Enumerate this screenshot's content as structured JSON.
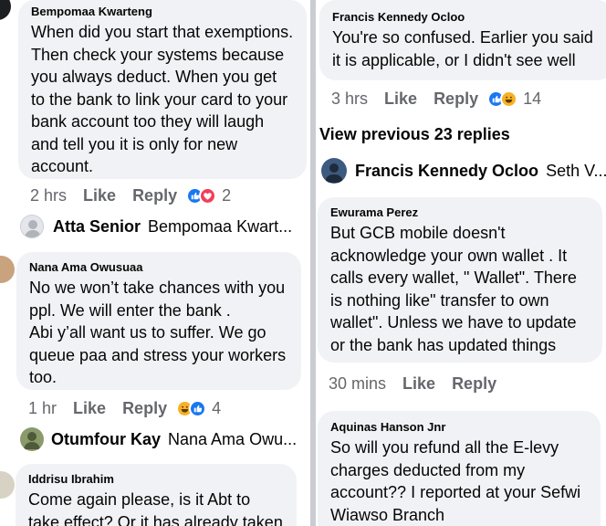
{
  "left": {
    "comments": [
      {
        "author": "Bempomaa Kwarteng",
        "text": "When did you start that exemptions. Then check your systems because you always deduct. When you get to the bank to link your card to your bank account too they will laugh and tell you it is only for new account.",
        "time": "2 hrs",
        "like": "Like",
        "reply": "Reply",
        "reactions": [
          "like-icon",
          "love-icon"
        ],
        "count": "2"
      },
      {
        "author": "Nana Ama Owusuaa",
        "text": "No we won’t take chances with you ppl. We will enter the bank .\nAbi y’all want us to suffer. We go queue paa and stress your workers too.",
        "time": "1 hr",
        "like": "Like",
        "reply": "Reply",
        "reactions": [
          "haha-icon",
          "like-icon"
        ],
        "count": "4"
      },
      {
        "author": "Iddrisu Ibrahim",
        "text": "Come again please, is it Abt to take effect? Or it has already taken"
      }
    ],
    "replies": [
      {
        "name": "Atta Senior",
        "preview": "Bempomaa Kwart..."
      },
      {
        "name": "Otumfour Kay",
        "preview": "Nana Ama Owu..."
      }
    ]
  },
  "right": {
    "comments": [
      {
        "author": "Francis Kennedy Ocloo",
        "text": "You're so confused. Earlier you said it is applicable, or I didn't see well",
        "time": "3 hrs",
        "like": "Like",
        "reply": "Reply",
        "reactions": [
          "like-icon",
          "haha-icon"
        ],
        "count": "14"
      },
      {
        "author": "Ewurama Perez",
        "text": "But GCB mobile doesn't acknowledge your own wallet . It calls every wallet, \" Wallet\".  There is nothing like\" transfer to own wallet\". Unless we have to update or the bank has updated things",
        "time": "30 mins",
        "like": "Like",
        "reply": "Reply"
      },
      {
        "author": "Aquinas Hanson Jnr",
        "text": "So will you refund all the E-levy charges deducted from my account?? I reported at your Sefwi Wiawso Branch"
      }
    ],
    "view_previous": "View previous 23 replies",
    "reply": {
      "name": "Francis Kennedy Ocloo",
      "preview": "Seth V..."
    }
  },
  "colors": {
    "bubble": "#f0f2f5",
    "meta": "#65676b",
    "like": "#1877f2",
    "love": "#f33e58",
    "haha": "#f7b125"
  }
}
